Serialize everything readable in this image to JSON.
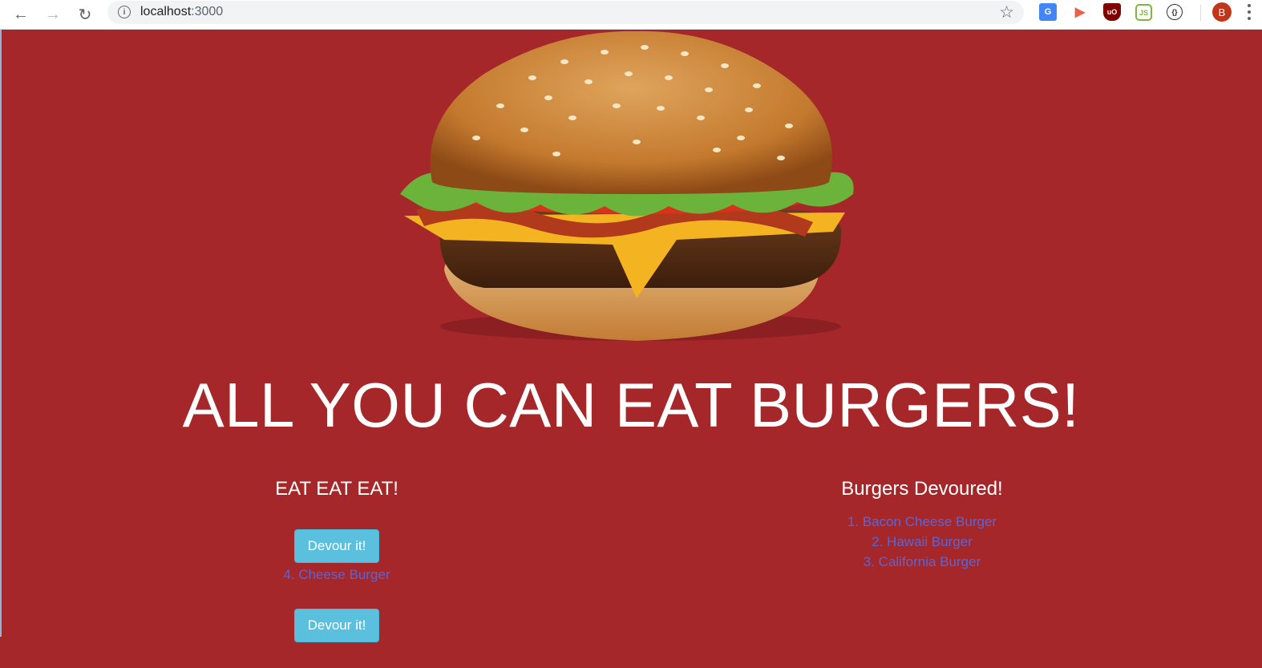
{
  "browser": {
    "url_host": "localhost",
    "url_port": ":3000",
    "avatar_letter": "B"
  },
  "page": {
    "title": "ALL YOU CAN EAT BURGERS!",
    "eat_heading": "EAT EAT EAT!",
    "devoured_heading": "Burgers Devoured!",
    "uneaten": [
      {
        "button_label": "Devour it!",
        "name": "4. Cheese Burger"
      },
      {
        "button_label": "Devour it!",
        "name": ""
      }
    ],
    "devoured": [
      "1. Bacon Cheese Burger",
      "2. Hawaii Burger",
      "3. California Burger"
    ]
  },
  "colors": {
    "background": "#a52729",
    "button": "#5bc0de",
    "link": "#5966d9"
  }
}
